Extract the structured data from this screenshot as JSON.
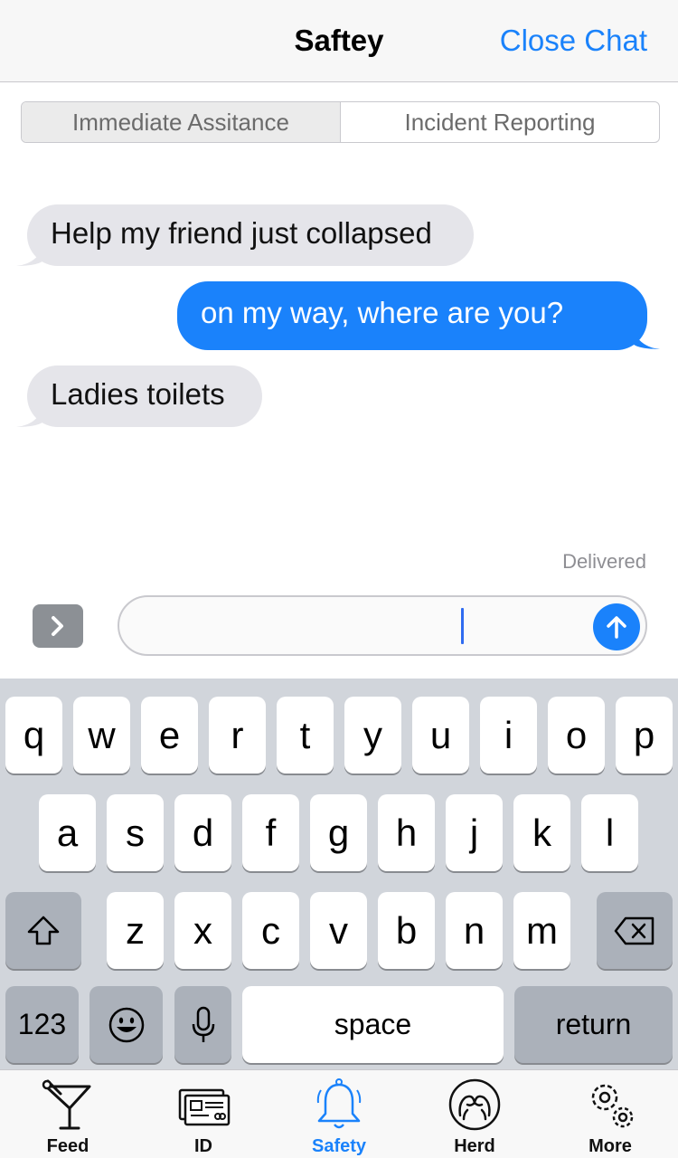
{
  "header": {
    "title": "Saftey",
    "close_label": "Close Chat"
  },
  "segments": [
    {
      "label": "Immediate Assitance",
      "active": true
    },
    {
      "label": "Incident Reporting",
      "active": false
    }
  ],
  "messages": [
    {
      "direction": "incoming",
      "text": "Help my friend just collapsed"
    },
    {
      "direction": "outgoing",
      "text": "on my way, where are you?"
    },
    {
      "direction": "incoming",
      "text": "Ladies toilets"
    }
  ],
  "status": {
    "delivered": "Delivered"
  },
  "composer": {
    "value": "",
    "placeholder": ""
  },
  "keyboard": {
    "row1": [
      "q",
      "w",
      "e",
      "r",
      "t",
      "y",
      "u",
      "i",
      "o",
      "p"
    ],
    "row2": [
      "a",
      "s",
      "d",
      "f",
      "g",
      "h",
      "j",
      "k",
      "l"
    ],
    "row3": [
      "z",
      "x",
      "c",
      "v",
      "b",
      "n",
      "m"
    ],
    "numbers_label": "123",
    "space_label": "space",
    "return_label": "return"
  },
  "tabs": [
    {
      "label": "Feed",
      "icon": "cocktail-icon"
    },
    {
      "label": "ID",
      "icon": "id-card-icon"
    },
    {
      "label": "Safety",
      "icon": "bell-icon",
      "active": true
    },
    {
      "label": "Herd",
      "icon": "herd-icon"
    },
    {
      "label": "More",
      "icon": "gears-icon"
    }
  ],
  "colors": {
    "accent": "#1a82fb",
    "incoming_bubble": "#e5e5ea",
    "keyboard_bg": "#d1d5db"
  }
}
